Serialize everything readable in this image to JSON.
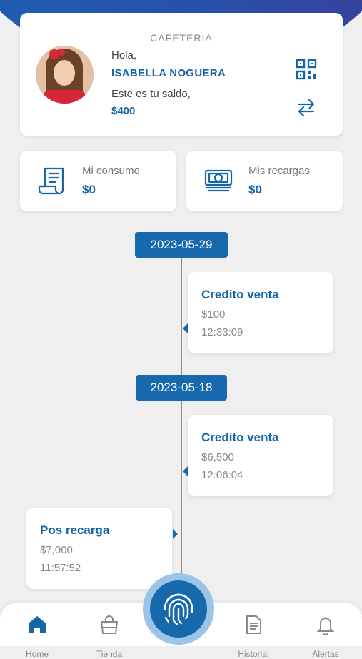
{
  "profile": {
    "section": "CAFETERIA",
    "greeting": "Hola,",
    "name": "ISABELLA NOGUERA",
    "balance_label": "Este es tu saldo,",
    "balance": "$400"
  },
  "summary": {
    "consumo": {
      "label": "Mi consumo",
      "value": "$0"
    },
    "recargas": {
      "label": "Mis recargas",
      "value": "$0"
    }
  },
  "timeline": {
    "dates": [
      "2023-05-29",
      "2023-05-18"
    ],
    "entries": [
      {
        "title": "Credito venta",
        "amount": "$100",
        "time": "12:33:09"
      },
      {
        "title": "Credito venta",
        "amount": "$6,500",
        "time": "12:06:04"
      },
      {
        "title": "Pos recarga",
        "amount": "$7,000",
        "time": "11:57:52"
      }
    ]
  },
  "nav": {
    "items": [
      {
        "label": "Home"
      },
      {
        "label": "Tienda"
      },
      {
        "label": "Historial"
      },
      {
        "label": "Alertas"
      }
    ]
  },
  "colors": {
    "accent": "#1565a8",
    "badge": "#1769ad",
    "header_gradient": [
      "#1c5fb4",
      "#3a3f99"
    ]
  },
  "icons": [
    "qr-code-icon",
    "swap-icon",
    "receipt-icon",
    "money-icon",
    "home-icon",
    "shopping-bag-icon",
    "document-icon",
    "bell-icon",
    "fingerprint-icon"
  ]
}
